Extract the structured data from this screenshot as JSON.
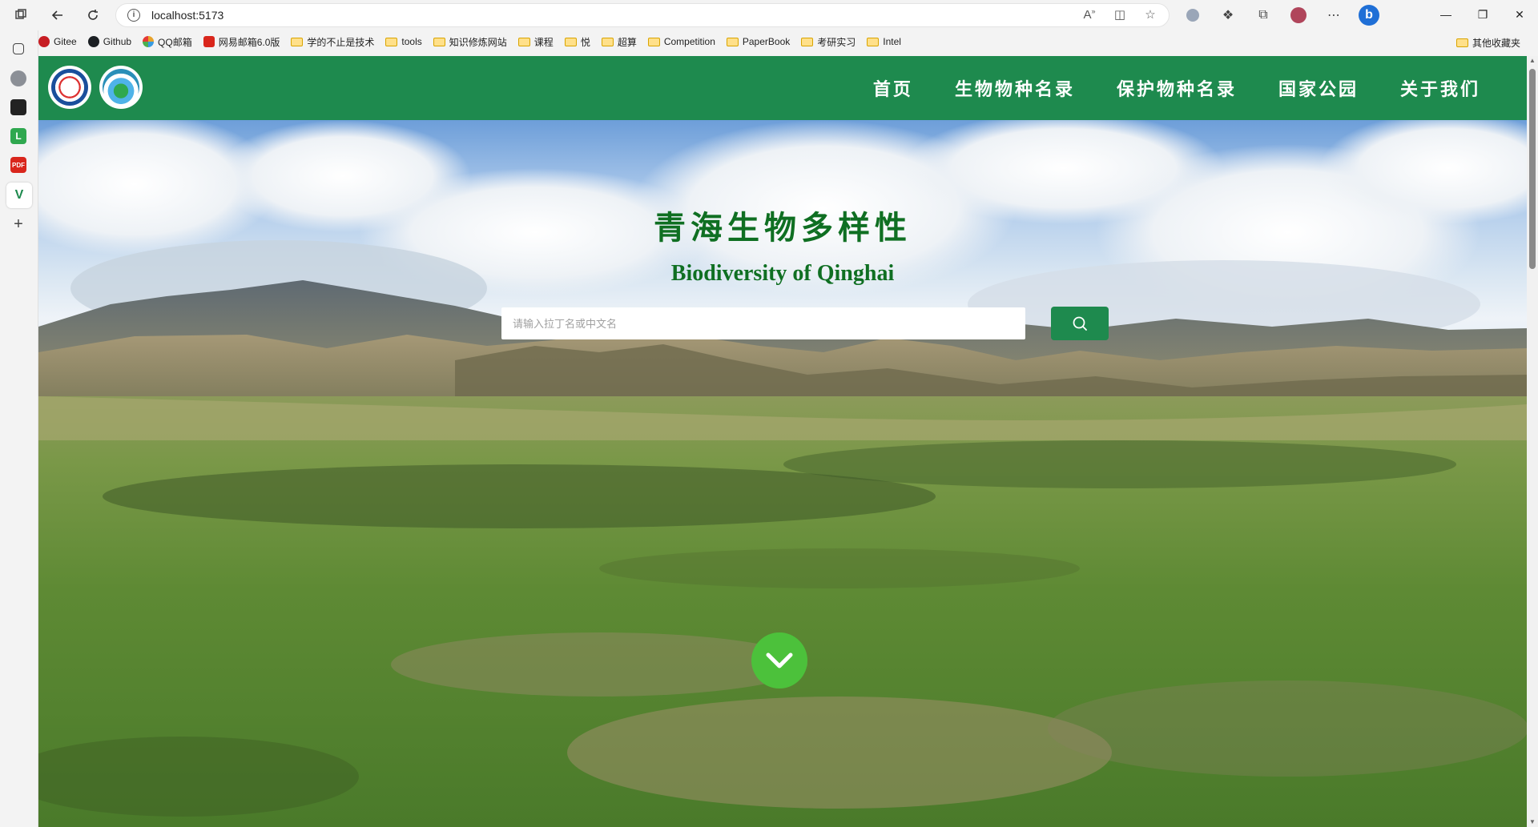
{
  "browser": {
    "url": "localhost:5173",
    "bookmarks": [
      {
        "label": "Gitee",
        "icon": "gitee-icon",
        "color": "#c71d23"
      },
      {
        "label": "Github",
        "icon": "github-icon",
        "color": "#1b1f23"
      },
      {
        "label": "QQ邮箱",
        "icon": "qq-mail-icon",
        "color": "#e7a32b"
      },
      {
        "label": "网易邮箱6.0版",
        "icon": "netease-mail-icon",
        "color": "#d9261c"
      },
      {
        "label": "学的不止是技术",
        "icon": "folder-icon"
      },
      {
        "label": "tools",
        "icon": "folder-icon"
      },
      {
        "label": "知识修炼网站",
        "icon": "folder-icon"
      },
      {
        "label": "课程",
        "icon": "folder-icon"
      },
      {
        "label": "悦",
        "icon": "folder-icon"
      },
      {
        "label": "超算",
        "icon": "folder-icon"
      },
      {
        "label": "Competition",
        "icon": "folder-icon"
      },
      {
        "label": "PaperBook",
        "icon": "folder-icon"
      },
      {
        "label": "考研实习",
        "icon": "folder-icon"
      },
      {
        "label": "Intel",
        "icon": "folder-icon"
      }
    ],
    "other_bookmarks": "其他收藏夹"
  },
  "site": {
    "nav": [
      "首页",
      "生物物种名录",
      "保护物种名录",
      "国家公园",
      "关于我们"
    ],
    "hero_title": "青海生物多样性",
    "hero_subtitle": "Biodiversity of Qinghai",
    "search_placeholder": "请输入拉丁名或中文名"
  },
  "colors": {
    "brand_green": "#1e8a4e",
    "title_green": "#0f6f22",
    "scroll_button": "#4cc13b"
  }
}
